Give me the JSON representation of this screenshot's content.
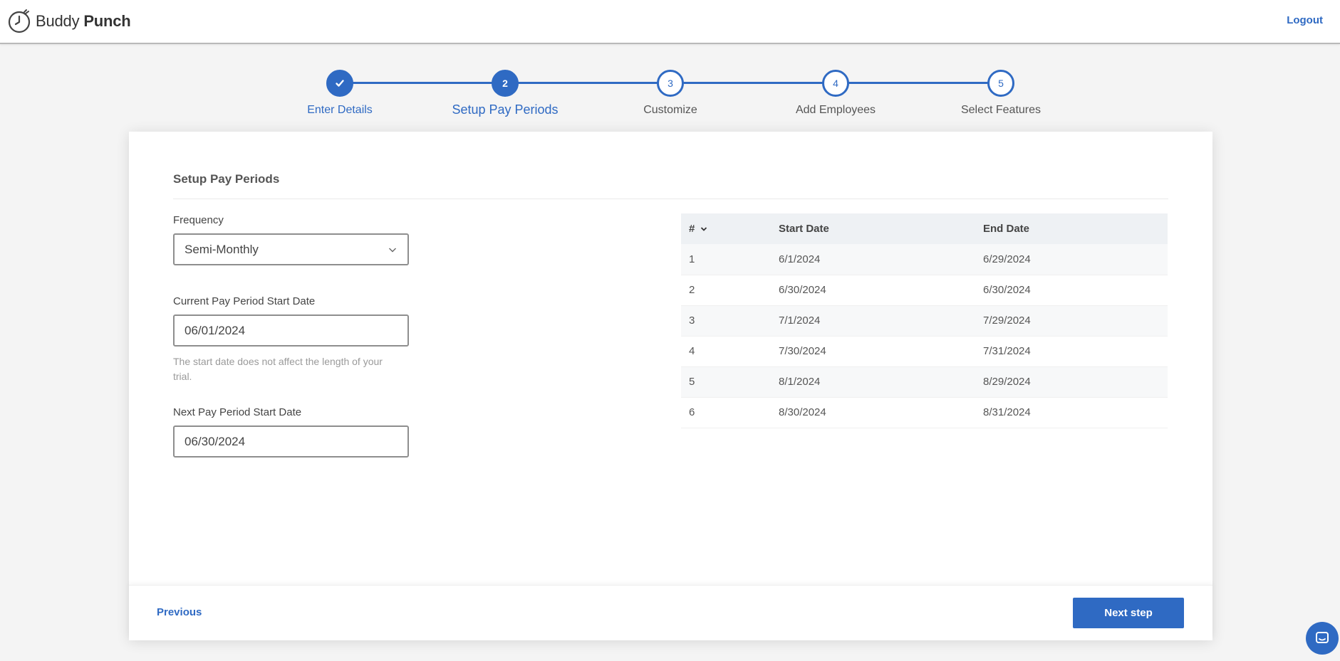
{
  "brand": {
    "name_light": "Buddy",
    "name_bold": "Punch",
    "accent_color": "#2f6ac3"
  },
  "header": {
    "logout_label": "Logout"
  },
  "stepper": {
    "steps": [
      {
        "number": "1",
        "label": "Enter Details",
        "state": "done",
        "icon": "check-icon"
      },
      {
        "number": "2",
        "label": "Setup Pay Periods",
        "state": "active"
      },
      {
        "number": "3",
        "label": "Customize",
        "state": "pending"
      },
      {
        "number": "4",
        "label": "Add Employees",
        "state": "pending"
      },
      {
        "number": "5",
        "label": "Select Features",
        "state": "pending"
      }
    ]
  },
  "form": {
    "title": "Setup Pay Periods",
    "frequency": {
      "label": "Frequency",
      "value": "Semi-Monthly"
    },
    "current_start": {
      "label": "Current Pay Period Start Date",
      "value": "06/01/2024",
      "hint": "The start date does not affect the length of your trial."
    },
    "next_start": {
      "label": "Next Pay Period Start Date",
      "value": "06/30/2024"
    }
  },
  "table": {
    "headers": {
      "num": "#",
      "start": "Start Date",
      "end": "End Date"
    },
    "rows": [
      {
        "num": "1",
        "start": "6/1/2024",
        "end": "6/29/2024"
      },
      {
        "num": "2",
        "start": "6/30/2024",
        "end": "6/30/2024"
      },
      {
        "num": "3",
        "start": "7/1/2024",
        "end": "7/29/2024"
      },
      {
        "num": "4",
        "start": "7/30/2024",
        "end": "7/31/2024"
      },
      {
        "num": "5",
        "start": "8/1/2024",
        "end": "8/29/2024"
      },
      {
        "num": "6",
        "start": "8/30/2024",
        "end": "8/31/2024"
      }
    ]
  },
  "footer": {
    "previous_label": "Previous",
    "next_label": "Next step"
  },
  "chat": {
    "icon": "chat-icon"
  }
}
